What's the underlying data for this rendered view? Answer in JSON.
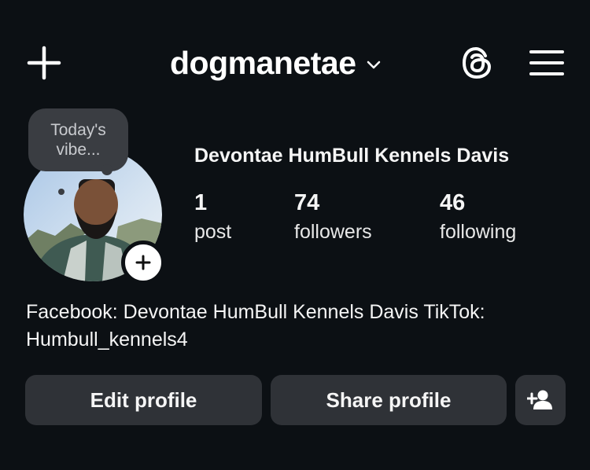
{
  "header": {
    "username": "dogmanetae"
  },
  "icons": {
    "new_post": "plus-icon",
    "account_switcher": "chevron-down-icon",
    "threads": "threads-icon",
    "menu": "hamburger-menu-icon",
    "add_story": "plus-circle-icon",
    "discover_people": "add-person-icon"
  },
  "profile": {
    "note": "Today's\nvibe...",
    "display_name": "Devontae HumBull Kennels Davis",
    "stats": {
      "posts_count": "1",
      "posts_label": "post",
      "followers_count": "74",
      "followers_label": "followers",
      "following_count": "46",
      "following_label": "following"
    },
    "bio": "Facebook: Devontae HumBull Kennels Davis TikTok: Humbull_kennels4"
  },
  "actions": {
    "edit_label": "Edit profile",
    "share_label": "Share profile"
  },
  "colors": {
    "background": "#0c1014",
    "button": "#2f3237",
    "text": "#f5f5f5"
  }
}
